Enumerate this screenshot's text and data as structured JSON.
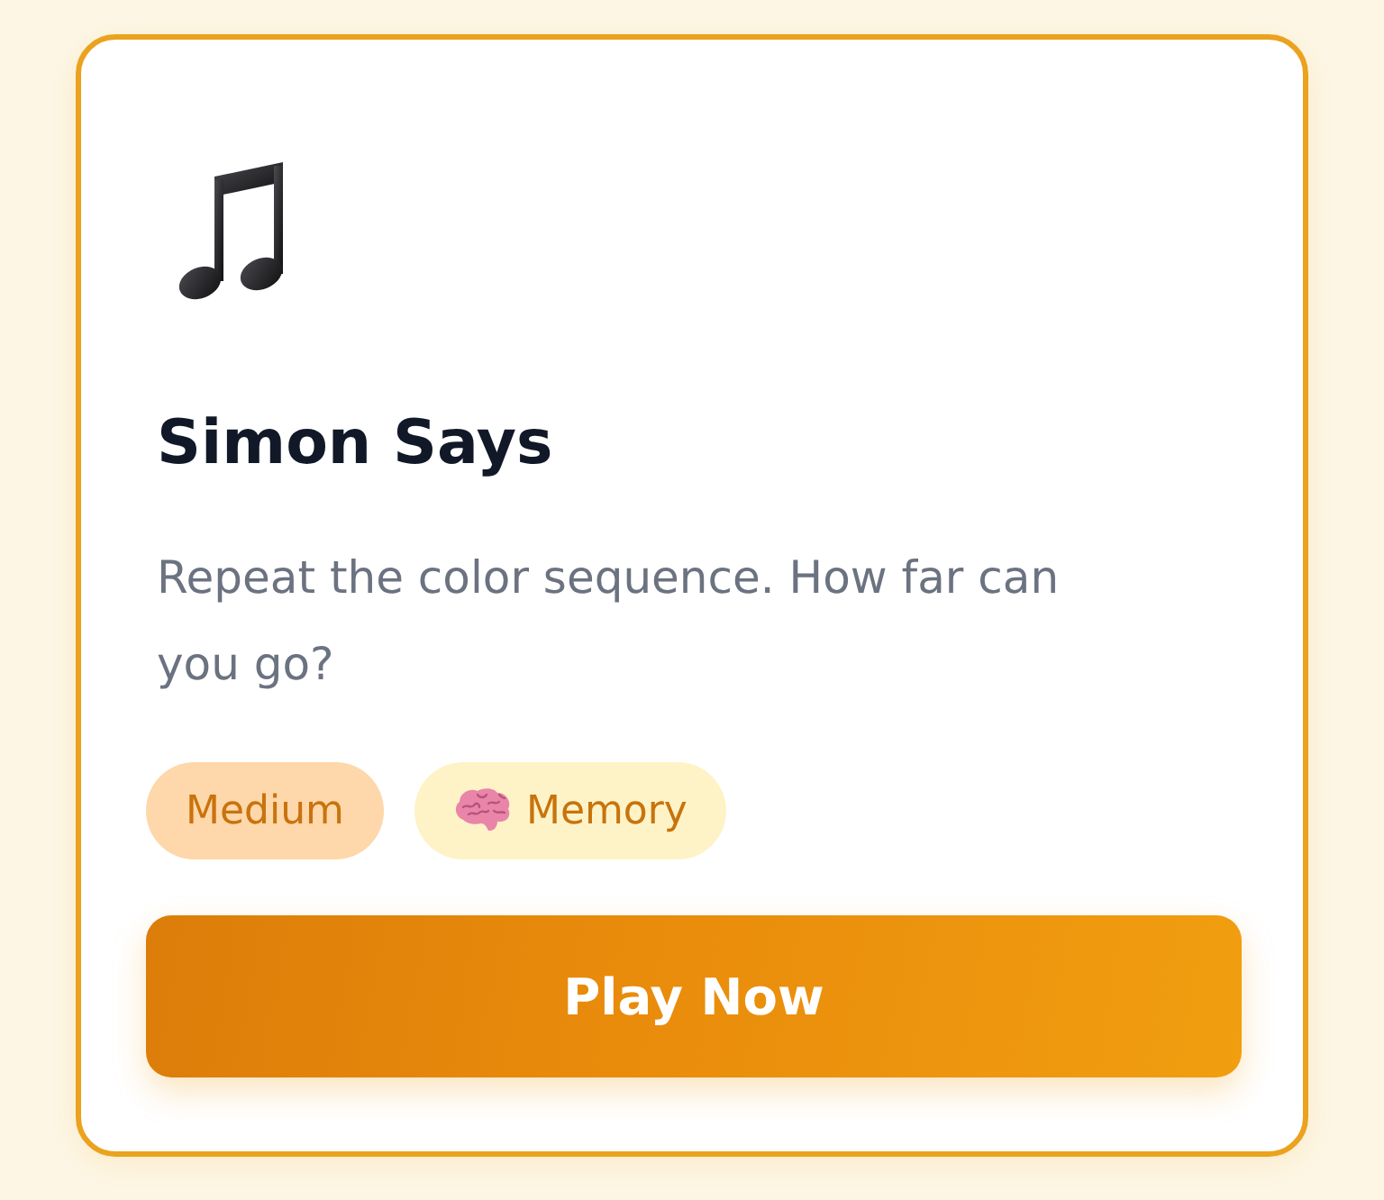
{
  "card": {
    "title": "Simon Says",
    "description": "Repeat the color sequence. How far can you go?",
    "tags": [
      {
        "label": "Medium",
        "kind": "difficulty"
      },
      {
        "label": "Memory",
        "kind": "category"
      }
    ],
    "button": "Play Now"
  }
}
